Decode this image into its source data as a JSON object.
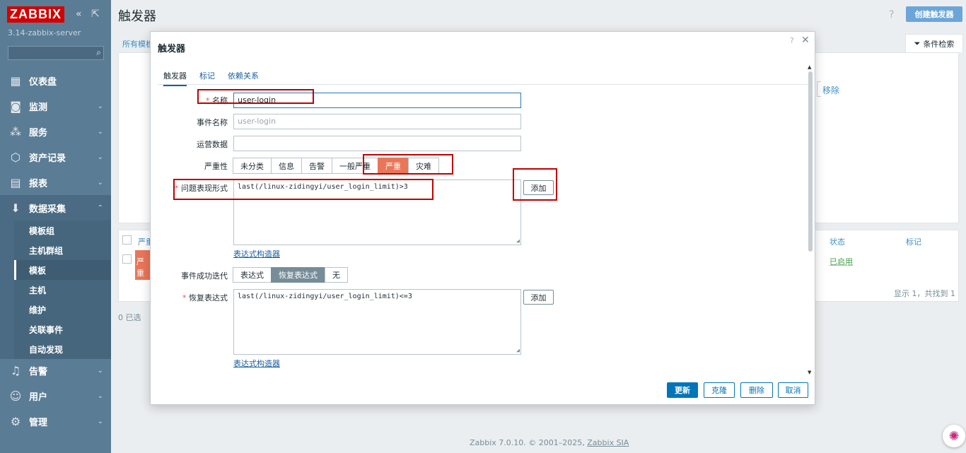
{
  "app": {
    "logo": "ZABBIX",
    "server": "3.14-zabbix-server",
    "page_title": "触发器",
    "create_button": "创建触发器",
    "help": "?"
  },
  "sidebar": {
    "items": [
      {
        "label": "仪表盘",
        "icon": "dashboard-icon",
        "glyph": "▦"
      },
      {
        "label": "监测",
        "icon": "monitoring-icon",
        "glyph": "◙"
      },
      {
        "label": "服务",
        "icon": "services-icon",
        "glyph": "⁂"
      },
      {
        "label": "资产记录",
        "icon": "inventory-icon",
        "glyph": "⬡"
      },
      {
        "label": "报表",
        "icon": "reports-icon",
        "glyph": "▤"
      },
      {
        "label": "数据采集",
        "icon": "data-collection-icon",
        "glyph": "⬇"
      },
      {
        "label": "告警",
        "icon": "alerts-icon",
        "glyph": "♫"
      },
      {
        "label": "用户",
        "icon": "users-icon",
        "glyph": "☺"
      },
      {
        "label": "管理",
        "icon": "administration-icon",
        "glyph": "⚙"
      }
    ],
    "sub_items": [
      "模板组",
      "主机群组",
      "模板",
      "主机",
      "维护",
      "关联事件",
      "自动发现"
    ]
  },
  "main": {
    "breadcrumb": "所有模板",
    "filter_label": "条件检索",
    "remove_link": "移除",
    "columns": {
      "severity": "严重",
      "status": "状态",
      "tags": "标记"
    },
    "row": {
      "severity": "严重",
      "status": "已启用"
    },
    "found_text": "显示 1，共找到 1",
    "selected_text": "0 已选"
  },
  "dialog": {
    "title": "触发器",
    "help": "?",
    "close": "✕",
    "tabs": [
      "触发器",
      "标记",
      "依赖关系"
    ],
    "name_label": "名称",
    "name_value": "user-login",
    "event_name_label": "事件名称",
    "event_name_placeholder": "user-login",
    "opdata_label": "运营数据",
    "opdata_value": "",
    "severity_label": "严重性",
    "severities": [
      "未分类",
      "信息",
      "告警",
      "一般严重",
      "严重",
      "灾难"
    ],
    "severity_selected": "严重",
    "expression_label": "问题表现形式",
    "expression_value": "last(/linux-zidingyi/user_login_limit)>3",
    "add_label": "添加",
    "constructor_label": "表达式构造器",
    "ok_event_label": "事件成功迭代",
    "ok_event_options": [
      "表达式",
      "恢复表达式",
      "无"
    ],
    "ok_event_selected": "恢复表达式",
    "recovery_label": "恢复表达式",
    "recovery_value": "last(/linux-zidingyi/user_login_limit)<=3",
    "buttons": {
      "update": "更新",
      "clone": "克隆",
      "delete": "删除",
      "cancel": "取消"
    }
  },
  "footer": {
    "text": "Zabbix 7.0.10. © 2001–2025, ",
    "company": "Zabbix SIA"
  },
  "colors": {
    "sidebar": "#5b7c95",
    "accent": "#0275b8",
    "severity_high": "#e97659",
    "highlight": "#c00000"
  }
}
